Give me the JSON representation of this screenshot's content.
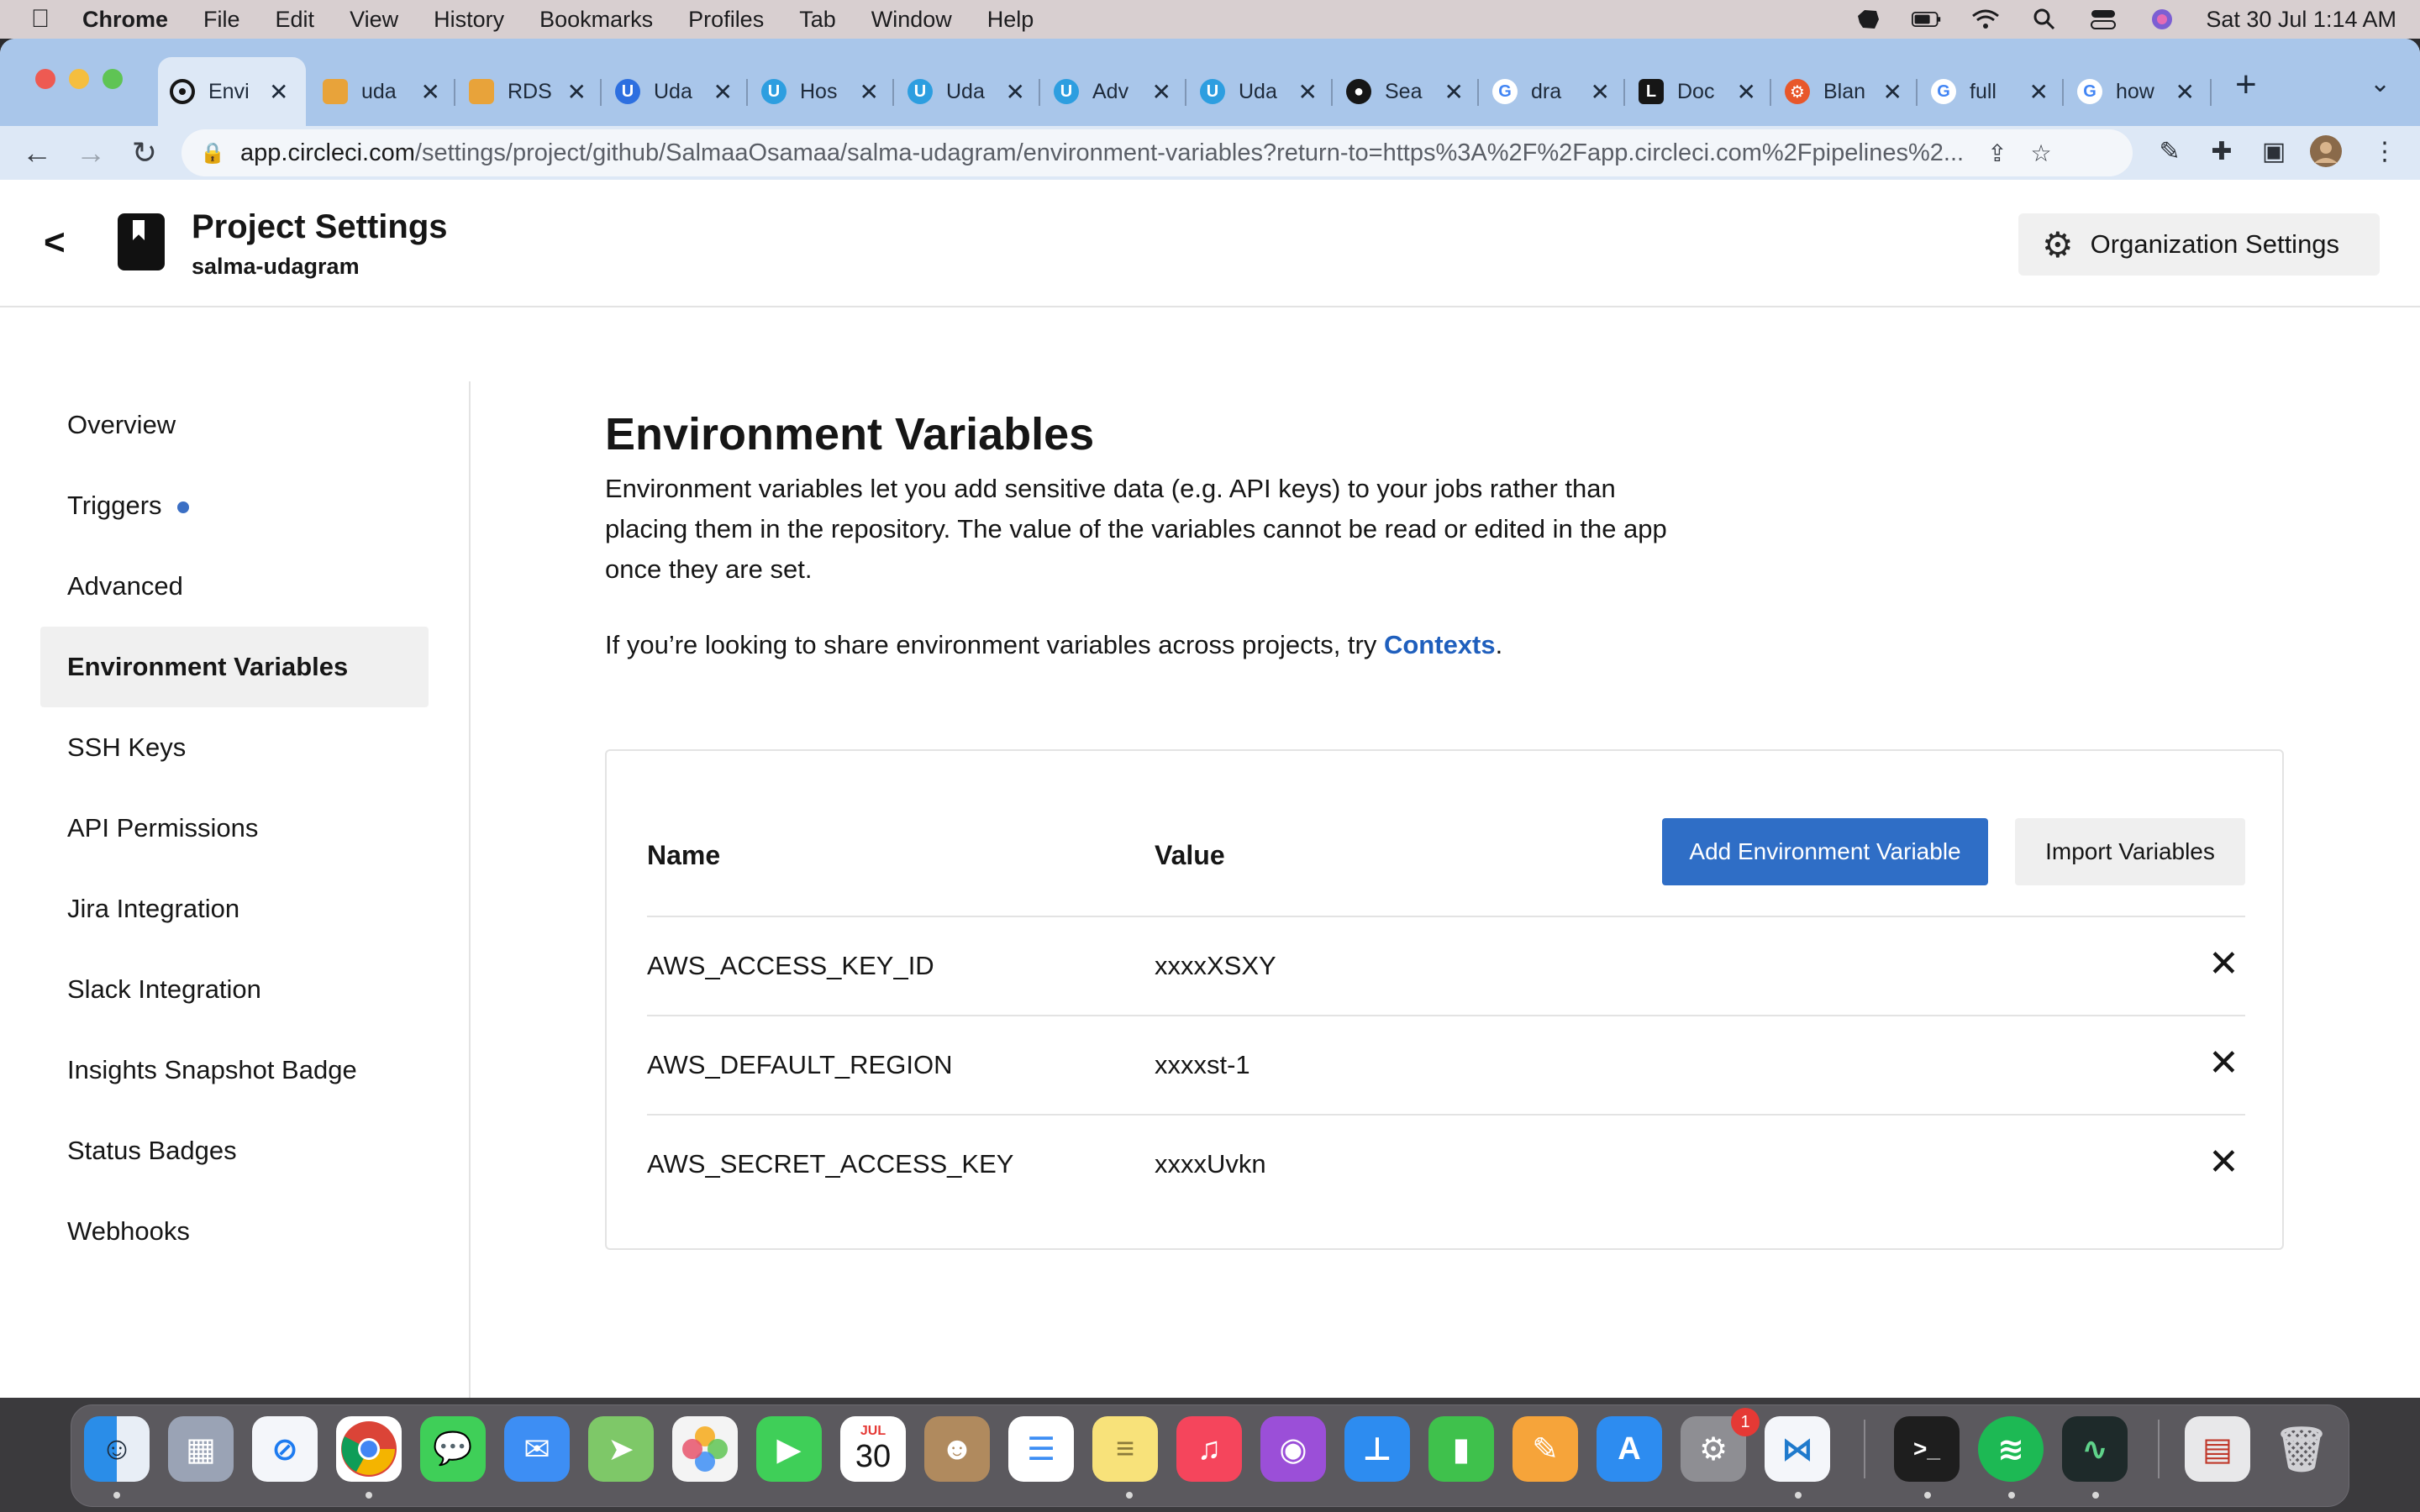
{
  "menubar": {
    "app": "Chrome",
    "items": [
      "File",
      "Edit",
      "View",
      "History",
      "Bookmarks",
      "Profiles",
      "Tab",
      "Window",
      "Help"
    ],
    "clock": "Sat 30 Jul  1:14 AM"
  },
  "tabs": [
    {
      "label": "Envi",
      "favicon": "circleci-icon",
      "color": "#161616",
      "active": true
    },
    {
      "label": "uda",
      "favicon": "aws-icon",
      "color": "#e8a33a"
    },
    {
      "label": "RDS",
      "favicon": "aws-icon",
      "color": "#e8a33a"
    },
    {
      "label": "Uda",
      "favicon": "udacity-icon",
      "color": "#2d6fe0"
    },
    {
      "label": "Hos",
      "favicon": "udacity-icon",
      "color": "#2d9ee0"
    },
    {
      "label": "Uda",
      "favicon": "udacity-icon",
      "color": "#2d9ee0"
    },
    {
      "label": "Adv",
      "favicon": "udacity-icon",
      "color": "#2d9ee0"
    },
    {
      "label": "Uda",
      "favicon": "udacity-icon",
      "color": "#2d9ee0"
    },
    {
      "label": "Sea",
      "favicon": "github-icon",
      "color": "#161616"
    },
    {
      "label": "dra",
      "favicon": "google-icon",
      "color": "#4285f4"
    },
    {
      "label": "Doc",
      "favicon": "docs-icon",
      "color": "#161616"
    },
    {
      "label": "Blan",
      "favicon": "figma-icon",
      "color": "#e8572a"
    },
    {
      "label": "full",
      "favicon": "google-icon",
      "color": "#4285f4"
    },
    {
      "label": "how",
      "favicon": "google-icon",
      "color": "#4285f4"
    }
  ],
  "address": {
    "host": "app.circleci.com",
    "path": "/settings/project/github/SalmaaOsamaa/salma-udagram/environment-variables?return-to=https%3A%2F%2Fapp.circleci.com%2Fpipelines%2..."
  },
  "header": {
    "title": "Project Settings",
    "subtitle": "salma-udagram",
    "org_button": "Organization Settings"
  },
  "sidebar": {
    "items": [
      {
        "label": "Overview"
      },
      {
        "label": "Triggers",
        "dot": true
      },
      {
        "label": "Advanced"
      },
      {
        "label": "Environment Variables",
        "active": true
      },
      {
        "label": "SSH Keys"
      },
      {
        "label": "API Permissions"
      },
      {
        "label": "Jira Integration"
      },
      {
        "label": "Slack Integration"
      },
      {
        "label": "Insights Snapshot Badge"
      },
      {
        "label": "Status Badges"
      },
      {
        "label": "Webhooks"
      }
    ]
  },
  "main": {
    "title": "Environment Variables",
    "description": "Environment variables let you add sensitive data (e.g. API keys) to your jobs rather than placing them in the repository. The value of the variables cannot be read or edited in the app once they are set.",
    "share_prefix": "If you’re looking to share environment variables across projects, try ",
    "share_link": "Contexts",
    "share_suffix": ".",
    "table": {
      "col_name": "Name",
      "col_value": "Value",
      "add_button": "Add Environment Variable",
      "import_button": "Import Variables",
      "rows": [
        {
          "name": "AWS_ACCESS_KEY_ID",
          "value": "xxxxXSXY"
        },
        {
          "name": "AWS_DEFAULT_REGION",
          "value": "xxxxst-1"
        },
        {
          "name": "AWS_SECRET_ACCESS_KEY",
          "value": "xxxxUvkn"
        }
      ]
    }
  },
  "dock": {
    "calendar_month": "JUL",
    "calendar_day": "30",
    "settings_badge": "1"
  }
}
